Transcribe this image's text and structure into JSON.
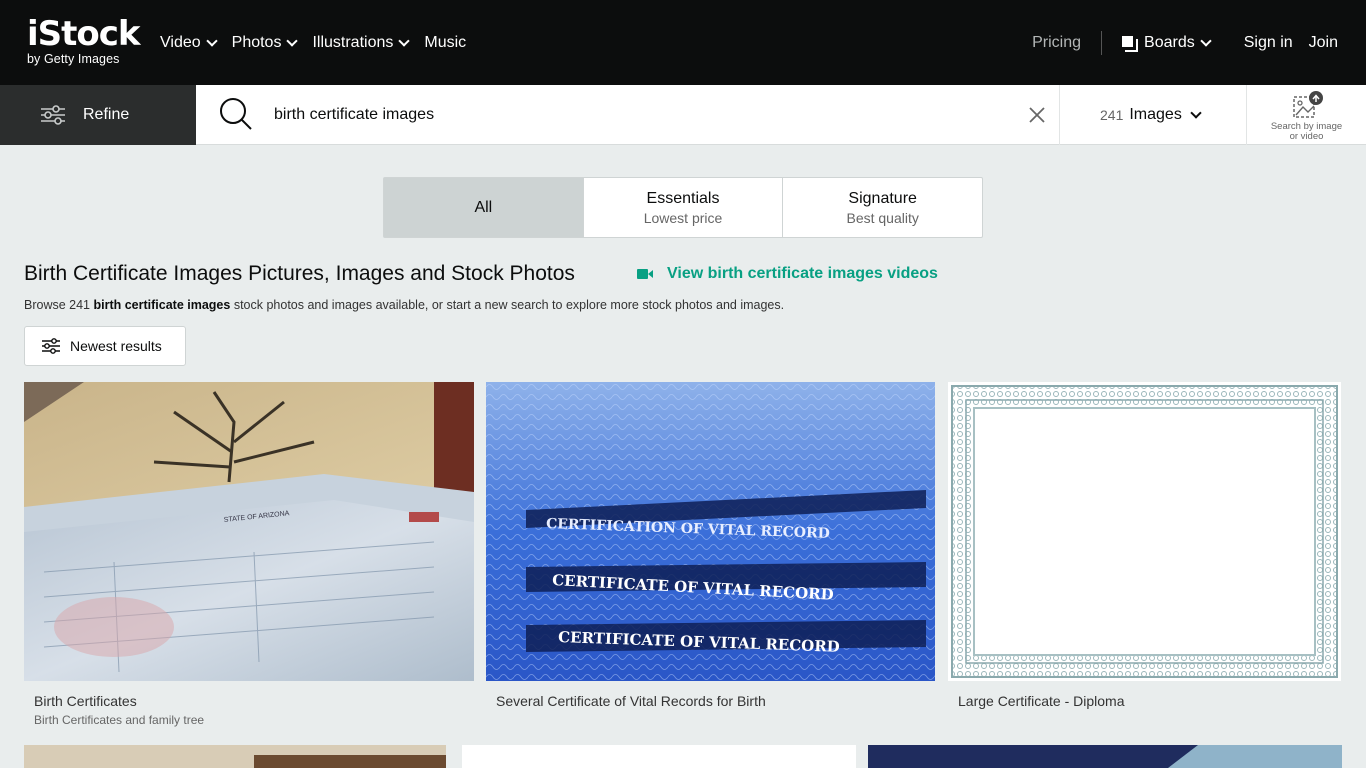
{
  "brand": {
    "logo_main": "iStock",
    "logo_sub": "by Getty Images"
  },
  "nav": {
    "items": [
      {
        "label": "Video",
        "has_menu": true
      },
      {
        "label": "Photos",
        "has_menu": true
      },
      {
        "label": "Illustrations",
        "has_menu": true
      },
      {
        "label": "Music",
        "has_menu": false
      }
    ],
    "pricing": "Pricing",
    "boards": "Boards",
    "sign_in": "Sign in",
    "join": "Join"
  },
  "search": {
    "refine_label": "Refine",
    "query": "birth certificate images",
    "result_count": "241",
    "media_type": "Images",
    "search_by_image_line1": "Search by image",
    "search_by_image_line2": "or video"
  },
  "tabs": [
    {
      "title": "All",
      "subtitle": "",
      "active": true
    },
    {
      "title": "Essentials",
      "subtitle": "Lowest price",
      "active": false
    },
    {
      "title": "Signature",
      "subtitle": "Best quality",
      "active": false
    }
  ],
  "headline": {
    "title": "Birth Certificate Images Pictures, Images and Stock Photos",
    "video_link": "View birth certificate images videos",
    "browse_prefix": "Browse 241 ",
    "browse_bold": "birth certificate images",
    "browse_suffix": " stock photos and images available, or start a new search to explore more stock photos and images."
  },
  "sort": {
    "label": "Newest results"
  },
  "results": [
    {
      "title": "Birth Certificates",
      "subtitle": "Birth Certificates and family tree"
    },
    {
      "title": "Several Certificate of Vital Records for Birth",
      "subtitle": ""
    },
    {
      "title": "Large Certificate - Diploma",
      "subtitle": ""
    }
  ],
  "image_text": {
    "vital_record_1": "CERTIFICATION OF VITAL RECORD",
    "vital_record_2": "CERTIFICATE OF VITAL RECORD",
    "vital_record_3": "CERTIFICATE OF VITAL RECORD",
    "arizona": "STATE OF ARIZONA"
  },
  "colors": {
    "accent": "#08a083",
    "topbar": "#0c0d0d",
    "refine_bg": "#2b2d2d"
  }
}
